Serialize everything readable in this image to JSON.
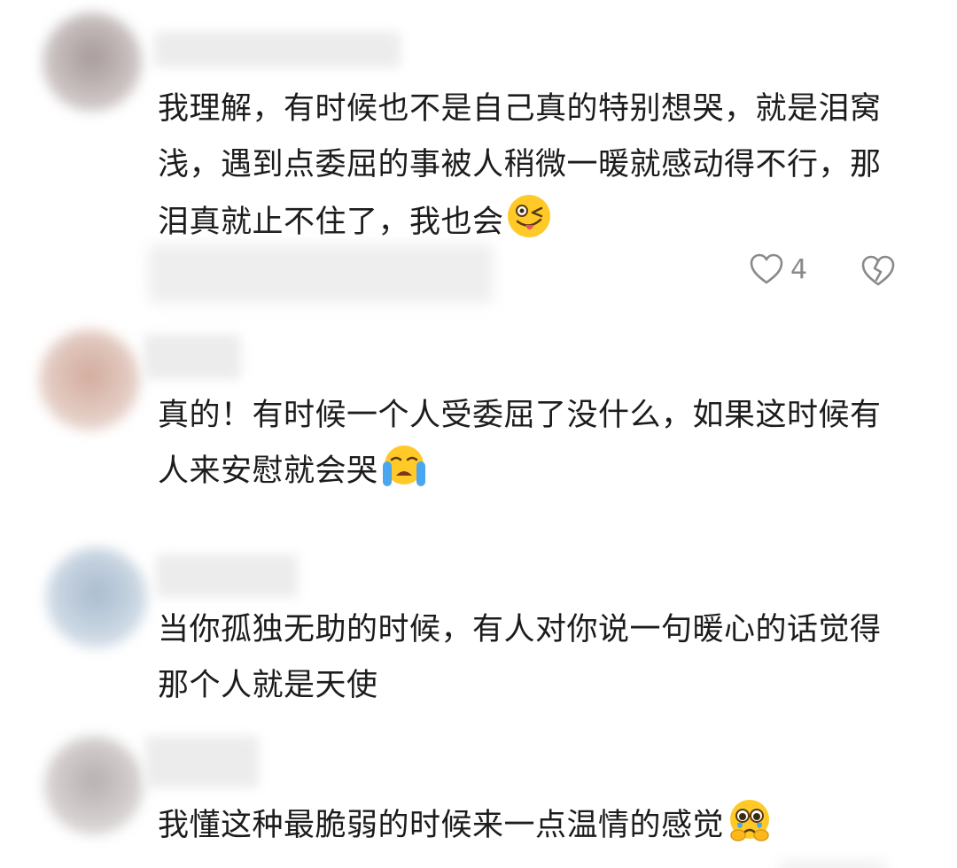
{
  "comments": [
    {
      "text": "我理解，有时候也不是自己真的特别想哭，就是泪窝浅，遇到点委屈的事被人稍微一暖就感动得不行，那泪真就止不住了，我也会",
      "emoji": "winking-tongue-face",
      "like_count": "4",
      "avatar_color": "#b3a7a7"
    },
    {
      "text": "真的！有时候一个人受委屈了没什么，如果这时候有人来安慰就会哭",
      "emoji": "loudly-crying-face",
      "avatar_color": "#d8b6aa"
    },
    {
      "text": "当你孤独无助的时候，有人对你说一句暖心的话觉得那个人就是天使",
      "avatar_color": "#b9c8d6"
    },
    {
      "text": "我懂这种最脆弱的时候来一点温情的感觉",
      "emoji": "holding-back-tears-face",
      "avatar_color": "#c2bcbc"
    }
  ],
  "colors": {
    "text": "#1c1c1c",
    "icon": "#8a8a8a",
    "emoji_yellow": "#ffc928"
  }
}
